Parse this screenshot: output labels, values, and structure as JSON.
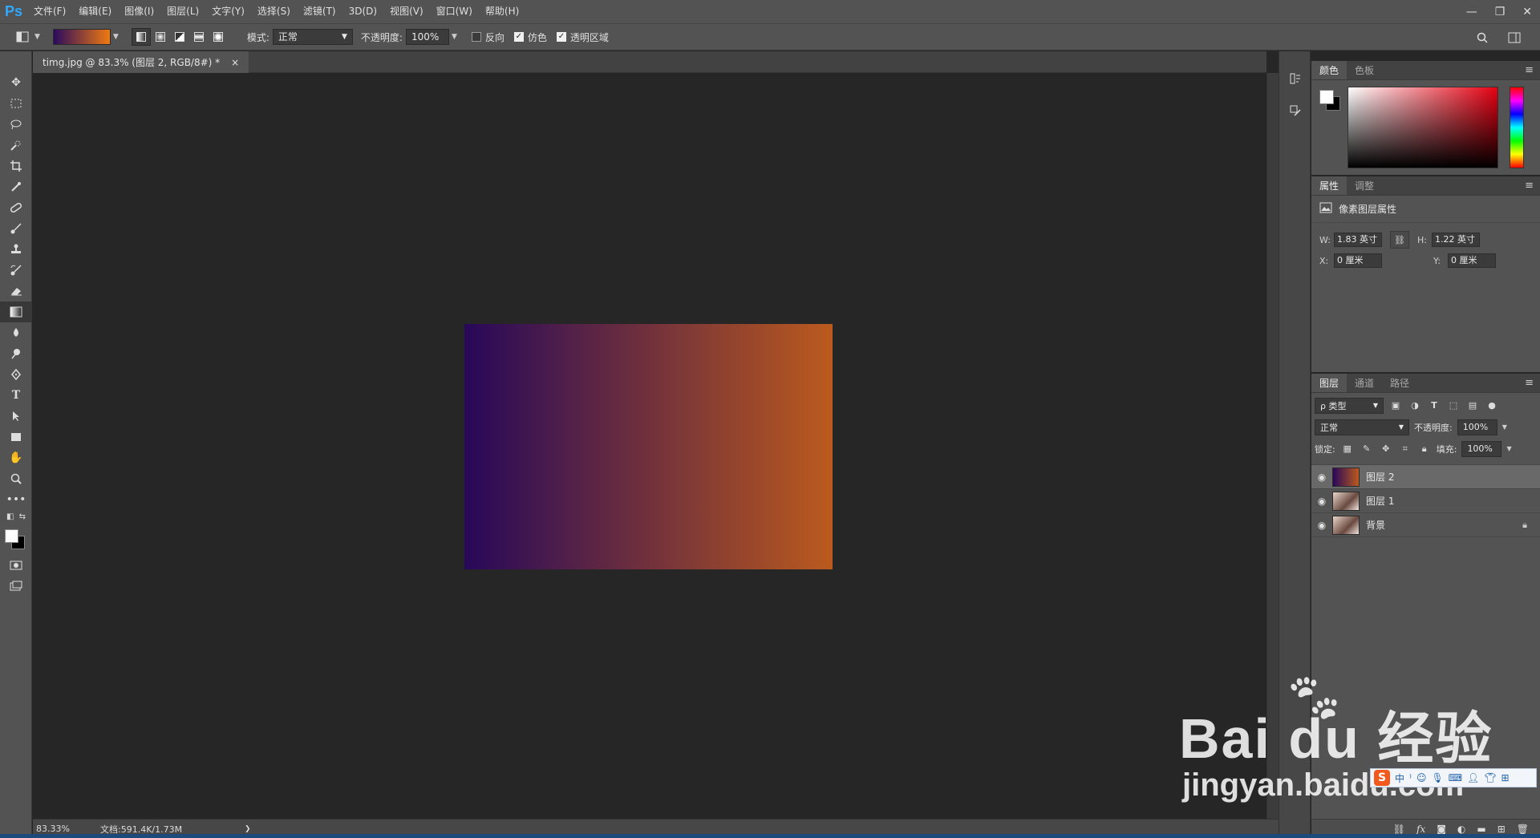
{
  "app": {
    "logo": "Ps"
  },
  "menu": [
    "文件(F)",
    "编辑(E)",
    "图像(I)",
    "图层(L)",
    "文字(Y)",
    "选择(S)",
    "滤镜(T)",
    "3D(D)",
    "视图(V)",
    "窗口(W)",
    "帮助(H)"
  ],
  "window_controls": {
    "minimize": "—",
    "restore": "❐",
    "close": "✕"
  },
  "options": {
    "mode_label": "模式:",
    "mode_value": "正常",
    "opacity_label": "不透明度:",
    "opacity_value": "100%",
    "reverse_label": "反向",
    "dither_label": "仿色",
    "transparency_label": "透明区域",
    "reverse_checked": false,
    "dither_checked": true,
    "transparency_checked": true
  },
  "gradient": {
    "start_color": "#28085a",
    "end_color": "#ba5a1e",
    "swatch_start": "#2a0a5e",
    "swatch_end": "#f07a10"
  },
  "document": {
    "tab_title": "timg.jpg @ 83.3% (图层 2, RGB/8#) *",
    "close": "×",
    "zoom": "83.33%",
    "doc_info": "文档:591.4K/1.73M",
    "status_arrow": "❯"
  },
  "color_panel": {
    "tabs": [
      "颜色",
      "色板"
    ]
  },
  "properties_panel": {
    "tabs": [
      "属性",
      "调整"
    ],
    "header": "像素图层属性",
    "w_label": "W:",
    "w_value": "1.83 英寸",
    "h_label": "H:",
    "h_value": "1.22 英寸",
    "x_label": "X:",
    "x_value": "0 厘米",
    "y_label": "Y:",
    "y_value": "0 厘米"
  },
  "layers_panel": {
    "tabs": [
      "图层",
      "通道",
      "路径"
    ],
    "filter_label": "ρ 类型",
    "blend_mode": "正常",
    "opacity_label": "不透明度:",
    "opacity_value": "100%",
    "lock_label": "锁定:",
    "fill_label": "填充:",
    "fill_value": "100%",
    "layers": [
      {
        "name": "图层 2",
        "selected": true
      },
      {
        "name": "图层 1",
        "selected": false
      },
      {
        "name": "背景",
        "selected": false,
        "locked": true
      }
    ],
    "footer_icons": [
      "link-icon",
      "fx-icon",
      "mask-icon",
      "adjustment-icon",
      "group-icon",
      "new-layer-icon",
      "trash-icon"
    ]
  },
  "watermark": {
    "brand": "Bai du 经验",
    "url": "jingyan.baidu.com"
  },
  "ime": {
    "logo": "S",
    "lang": "中"
  }
}
